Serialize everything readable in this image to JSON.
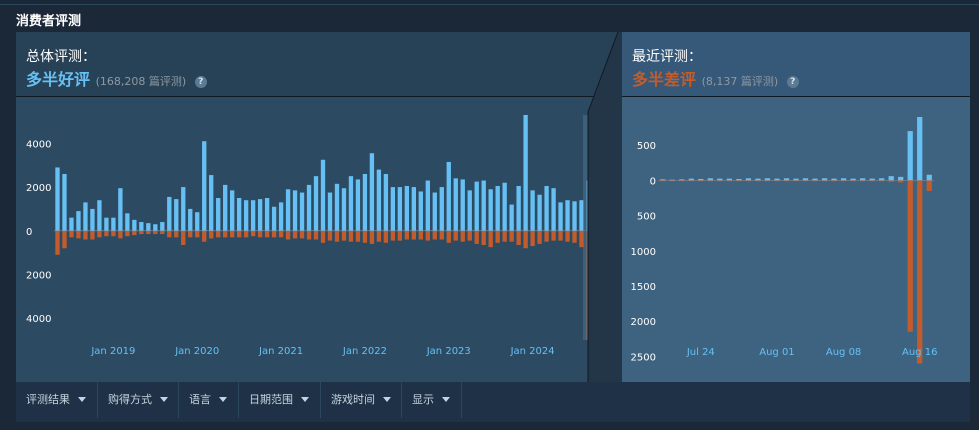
{
  "section_title": "消费者评测",
  "overall": {
    "title": "总体评测：",
    "summary": "多半好评",
    "count": "(168,208 篇评测)",
    "help": "?"
  },
  "recent": {
    "title": "最近评测：",
    "summary": "多半差评",
    "count": "(8,137 篇评测)",
    "help": "?"
  },
  "colors": {
    "positive": "#66c0f4",
    "negative": "#c35c2c",
    "panel": "#2c4a62",
    "panel_recent": "#3d6380"
  },
  "chart_data": [
    {
      "type": "bar",
      "chart": "overall-histogram",
      "y_tick_labels": [
        "4000",
        "2000",
        "0",
        "2000",
        "4000"
      ],
      "y_ticks": [
        4000,
        2000,
        0,
        -2000,
        -4000
      ],
      "ylim": [
        -5000,
        5300
      ],
      "x_tick_labels": [
        "Jan 2019",
        "Jan 2020",
        "Jan 2021",
        "Jan 2022",
        "Jan 2023",
        "Jan 2024"
      ],
      "x_tick_index": [
        8,
        20,
        32,
        44,
        56,
        68
      ],
      "series": [
        {
          "values": [
            2900,
            2600,
            600,
            900,
            1300,
            1000,
            1400,
            600,
            600,
            1950,
            800,
            500,
            400,
            350,
            300,
            400,
            1550,
            1450,
            2000,
            1000,
            850,
            4100,
            2550,
            1500,
            2100,
            1850,
            1500,
            1400,
            1400,
            1450,
            1500,
            1100,
            1300,
            1900,
            1850,
            1750,
            2100,
            2500,
            3250,
            1750,
            2150,
            1950,
            2500,
            2350,
            2600,
            3550,
            2800,
            2600,
            2000,
            2000,
            2050,
            2000,
            1800,
            2300,
            1750,
            2000,
            3150,
            2400,
            2350,
            1850,
            2250,
            2300,
            1900,
            2050,
            2200,
            1200,
            2050,
            5300,
            1850,
            1650,
            2050,
            1950,
            1300,
            1400,
            1350,
            1400,
            2300
          ]
        },
        {
          "values": [
            -1100,
            -800,
            -300,
            -350,
            -400,
            -400,
            -300,
            -250,
            -250,
            -350,
            -250,
            -200,
            -150,
            -150,
            -150,
            -150,
            -300,
            -300,
            -650,
            -300,
            -300,
            -500,
            -350,
            -300,
            -300,
            -300,
            -300,
            -300,
            -250,
            -300,
            -300,
            -300,
            -300,
            -400,
            -350,
            -350,
            -400,
            -400,
            -550,
            -450,
            -500,
            -450,
            -500,
            -500,
            -550,
            -600,
            -500,
            -550,
            -450,
            -450,
            -400,
            -400,
            -400,
            -450,
            -400,
            -400,
            -550,
            -450,
            -500,
            -450,
            -600,
            -650,
            -750,
            -550,
            -500,
            -500,
            -650,
            -800,
            -700,
            -600,
            -500,
            -450,
            -450,
            -500,
            -550,
            -750,
            -5000
          ]
        }
      ]
    },
    {
      "type": "bar",
      "chart": "recent-histogram",
      "y_tick_labels": [
        "500",
        "0",
        "500",
        "1000",
        "1500",
        "2000",
        "2500"
      ],
      "y_ticks": [
        500,
        0,
        -500,
        -1000,
        -1500,
        -2000,
        -2500
      ],
      "ylim": [
        -2650,
        900
      ],
      "x_tick_labels": [
        "Jul 24",
        "Aug 01",
        "Aug 08",
        "Aug 16"
      ],
      "x_tick_index": [
        4,
        12,
        19,
        27
      ],
      "series": [
        {
          "values": [
            15,
            10,
            15,
            25,
            20,
            30,
            25,
            25,
            20,
            30,
            25,
            30,
            25,
            30,
            25,
            30,
            25,
            30,
            25,
            30,
            25,
            30,
            25,
            30,
            60,
            50,
            700,
            900,
            80
          ]
        },
        {
          "values": [
            -5,
            -5,
            -5,
            -5,
            -5,
            -10,
            -5,
            -5,
            -5,
            -10,
            -5,
            -5,
            -5,
            -10,
            -5,
            -5,
            -5,
            -10,
            -5,
            -5,
            -5,
            -10,
            -5,
            -5,
            -20,
            -30,
            -2150,
            -2600,
            -150
          ]
        }
      ]
    }
  ],
  "filters": [
    {
      "label": "评测结果"
    },
    {
      "label": "购得方式"
    },
    {
      "label": "语言"
    },
    {
      "label": "日期范围"
    },
    {
      "label": "游戏时间"
    },
    {
      "label": "显示"
    }
  ]
}
